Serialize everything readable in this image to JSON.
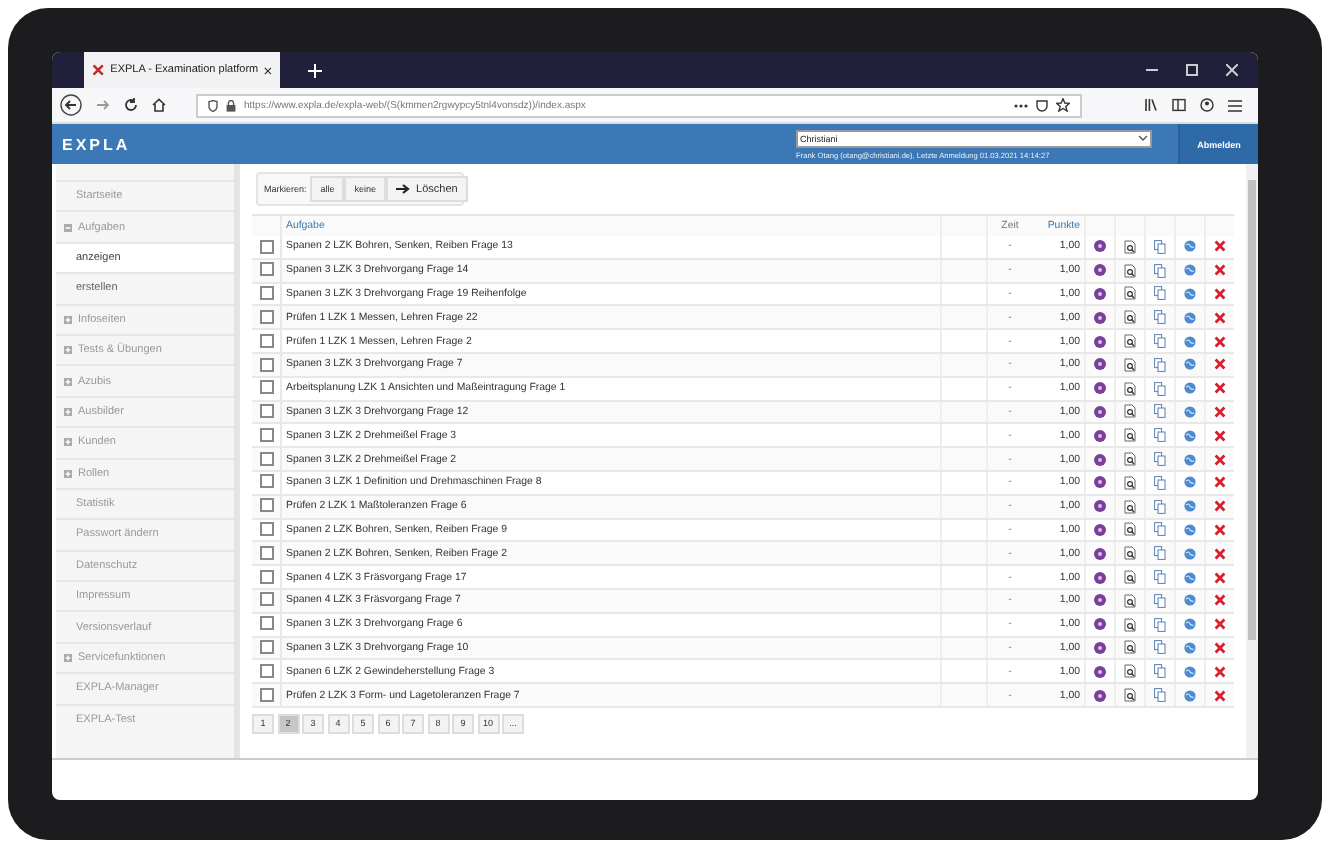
{
  "browser": {
    "tab_title": "EXPLA - Examination platform",
    "url": "https://www.expla.de/expla-web/(S(kmmen2rgwypcy5tnl4vonsdz))/index.aspx"
  },
  "header": {
    "logo": "EXPLA",
    "select_value": "Christiani",
    "user_info": "Frank Otang (otang@christiani.de), Letzte Anmeldung 01.03.2021 14:14:27",
    "logout": "Abmelden"
  },
  "sidebar": {
    "items": [
      {
        "kind": "link",
        "label": "Startseite",
        "selected": false
      },
      {
        "kind": "group",
        "label": "Aufgaben",
        "expanded": true,
        "selected": false,
        "children": [
          {
            "label": "anzeigen",
            "selected": true
          },
          {
            "label": "erstellen",
            "selected": false
          }
        ]
      },
      {
        "kind": "group",
        "label": "Infoseiten",
        "expanded": false,
        "selected": false
      },
      {
        "kind": "group",
        "label": "Tests & Übungen",
        "expanded": false,
        "selected": false
      },
      {
        "kind": "group",
        "label": "Azubis",
        "expanded": false,
        "selected": false
      },
      {
        "kind": "group",
        "label": "Ausbilder",
        "expanded": false,
        "selected": false
      },
      {
        "kind": "group",
        "label": "Kunden",
        "expanded": false,
        "selected": false
      },
      {
        "kind": "group",
        "label": "Rollen",
        "expanded": false,
        "selected": false
      },
      {
        "kind": "link",
        "label": "Statistik",
        "selected": false
      },
      {
        "kind": "link",
        "label": "Passwort ändern",
        "selected": false
      },
      {
        "kind": "link",
        "label": "Datenschutz",
        "selected": false
      },
      {
        "kind": "link",
        "label": "Impressum",
        "selected": false
      },
      {
        "kind": "link",
        "label": "Versionsverlauf",
        "selected": false
      },
      {
        "kind": "group",
        "label": "Servicefunktionen",
        "expanded": false,
        "selected": false
      },
      {
        "kind": "link",
        "label": "EXPLA-Manager",
        "selected": false
      },
      {
        "kind": "link",
        "label": "EXPLA-Test",
        "selected": false
      }
    ]
  },
  "toolbar": {
    "label": "Markieren:",
    "select_all": "alle",
    "select_none": "keine",
    "delete": "Löschen"
  },
  "table": {
    "columns": [
      "Aufgabe",
      "Zeit",
      "Punkte"
    ],
    "rows": [
      {
        "task": "Spanen 2 LZK Bohren, Senken, Reiben Frage 13",
        "zeit": "-",
        "punkte": "1,00",
        "checked": false
      },
      {
        "task": "Spanen 3 LZK 3 Drehvorgang Frage 14",
        "zeit": "-",
        "punkte": "1,00",
        "checked": false
      },
      {
        "task": "Spanen 3 LZK 3 Drehvorgang Frage 19 Reihenfolge",
        "zeit": "-",
        "punkte": "1,00",
        "checked": false
      },
      {
        "task": "Prüfen 1 LZK 1 Messen, Lehren Frage 22",
        "zeit": "-",
        "punkte": "1,00",
        "checked": false
      },
      {
        "task": "Prüfen 1 LZK 1 Messen, Lehren Frage 2",
        "zeit": "-",
        "punkte": "1,00",
        "checked": false
      },
      {
        "task": "Spanen 3 LZK 3 Drehvorgang Frage 7",
        "zeit": "-",
        "punkte": "1,00",
        "checked": false
      },
      {
        "task": "Arbeitsplanung LZK 1 Ansichten und Maßeintragung Frage 1",
        "zeit": "-",
        "punkte": "1,00",
        "checked": false
      },
      {
        "task": "Spanen 3 LZK 3 Drehvorgang Frage 12",
        "zeit": "-",
        "punkte": "1,00",
        "checked": false
      },
      {
        "task": "Spanen 3 LZK 2 Drehmeißel Frage 3",
        "zeit": "-",
        "punkte": "1,00",
        "checked": false
      },
      {
        "task": "Spanen 3 LZK 2 Drehmeißel Frage 2",
        "zeit": "-",
        "punkte": "1,00",
        "checked": false
      },
      {
        "task": "Spanen 3 LZK 1 Definition und Drehmaschinen Frage 8",
        "zeit": "-",
        "punkte": "1,00",
        "checked": false
      },
      {
        "task": "Prüfen 2 LZK 1 Maßtoleranzen Frage 6",
        "zeit": "-",
        "punkte": "1,00",
        "checked": false
      },
      {
        "task": "Spanen 2 LZK Bohren, Senken, Reiben Frage 9",
        "zeit": "-",
        "punkte": "1,00",
        "checked": false
      },
      {
        "task": "Spanen 2 LZK Bohren, Senken, Reiben Frage 2",
        "zeit": "-",
        "punkte": "1,00",
        "checked": false
      },
      {
        "task": "Spanen 4 LZK 3 Fräsvorgang Frage 17",
        "zeit": "-",
        "punkte": "1,00",
        "checked": false
      },
      {
        "task": "Spanen 4 LZK 3 Fräsvorgang Frage 7",
        "zeit": "-",
        "punkte": "1,00",
        "checked": false
      },
      {
        "task": "Spanen 3 LZK 3 Drehvorgang Frage 6",
        "zeit": "-",
        "punkte": "1,00",
        "checked": false
      },
      {
        "task": "Spanen 3 LZK 3 Drehvorgang Frage 10",
        "zeit": "-",
        "punkte": "1,00",
        "checked": false
      },
      {
        "task": "Spanen 6 LZK 2 Gewindeherstellung Frage 3",
        "zeit": "-",
        "punkte": "1,00",
        "checked": false
      },
      {
        "task": "Prüfen 2 LZK 3 Form- und Lagetoleranzen Frage 7",
        "zeit": "-",
        "punkte": "1,00",
        "checked": false
      }
    ]
  },
  "pagination": [
    {
      "label": "1",
      "selected": false
    },
    {
      "label": "2",
      "selected": true
    },
    {
      "label": "3",
      "selected": false
    },
    {
      "label": "4",
      "selected": false
    },
    {
      "label": "5",
      "selected": false
    },
    {
      "label": "6",
      "selected": false
    },
    {
      "label": "7",
      "selected": false
    },
    {
      "label": "8",
      "selected": false
    },
    {
      "label": "9",
      "selected": false
    },
    {
      "label": "10",
      "selected": false
    },
    {
      "label": "...",
      "selected": false
    }
  ]
}
